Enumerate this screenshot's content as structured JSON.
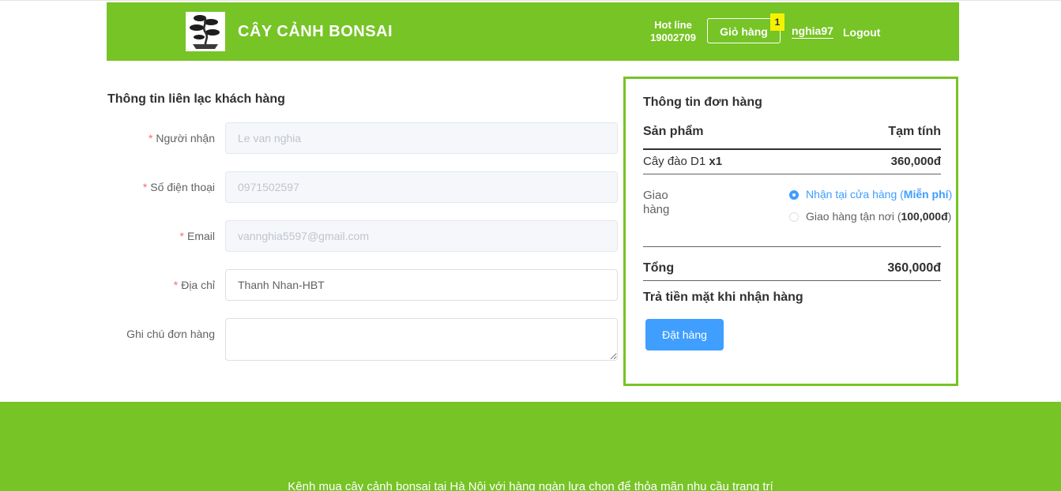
{
  "header": {
    "brand": "CÂY CẢNH BONSAI",
    "hotline_label": "Hot line",
    "hotline_number": "19002709",
    "cart_label": "Giỏ hàng",
    "cart_count": "1",
    "username": "nghia97",
    "logout_label": "Logout"
  },
  "customer_form": {
    "title": "Thông tin liên lạc khách hàng",
    "fields": [
      {
        "label": "Người nhận",
        "value": "Le van nghia",
        "required": true,
        "disabled": true
      },
      {
        "label": "Số điện thoại",
        "value": "0971502597",
        "required": true,
        "disabled": true
      },
      {
        "label": "Email",
        "value": "vannghia5597@gmail.com",
        "required": true,
        "disabled": true
      },
      {
        "label": "Địa chỉ",
        "value": "Thanh Nhan-HBT",
        "required": true,
        "disabled": false
      },
      {
        "label": "Ghi chú đơn hàng",
        "value": "",
        "required": false,
        "disabled": false
      }
    ]
  },
  "order": {
    "title": "Thông tin đơn hàng",
    "col_product": "Sản phẩm",
    "col_subtotal": "Tạm tính",
    "item_name": "Cây đào D1",
    "item_qty": "x1",
    "item_price": "360,000đ",
    "shipping_label": "Giao hàng",
    "shipping_options": [
      {
        "text": "Nhận tại cửa hàng (",
        "bold": "Miễn phí",
        "close": ")",
        "selected": true
      },
      {
        "text": "Giao hàng tận nơi (",
        "bold": "100,000đ",
        "close": ")",
        "selected": false
      }
    ],
    "total_label": "Tổng",
    "total_value": "360,000đ",
    "payment_method": "Trả tiền mặt khi nhận hàng",
    "submit_label": "Đặt hàng"
  },
  "footer": {
    "text": "Kênh mua cây cảnh bonsai tại Hà Nội với hàng ngàn lựa chọn để thỏa mãn nhu cầu trang trí"
  },
  "colors": {
    "brand_green": "#76c425",
    "primary_blue": "#409eff",
    "required_red": "#f56c6c",
    "badge_yellow": "#f5f200"
  }
}
